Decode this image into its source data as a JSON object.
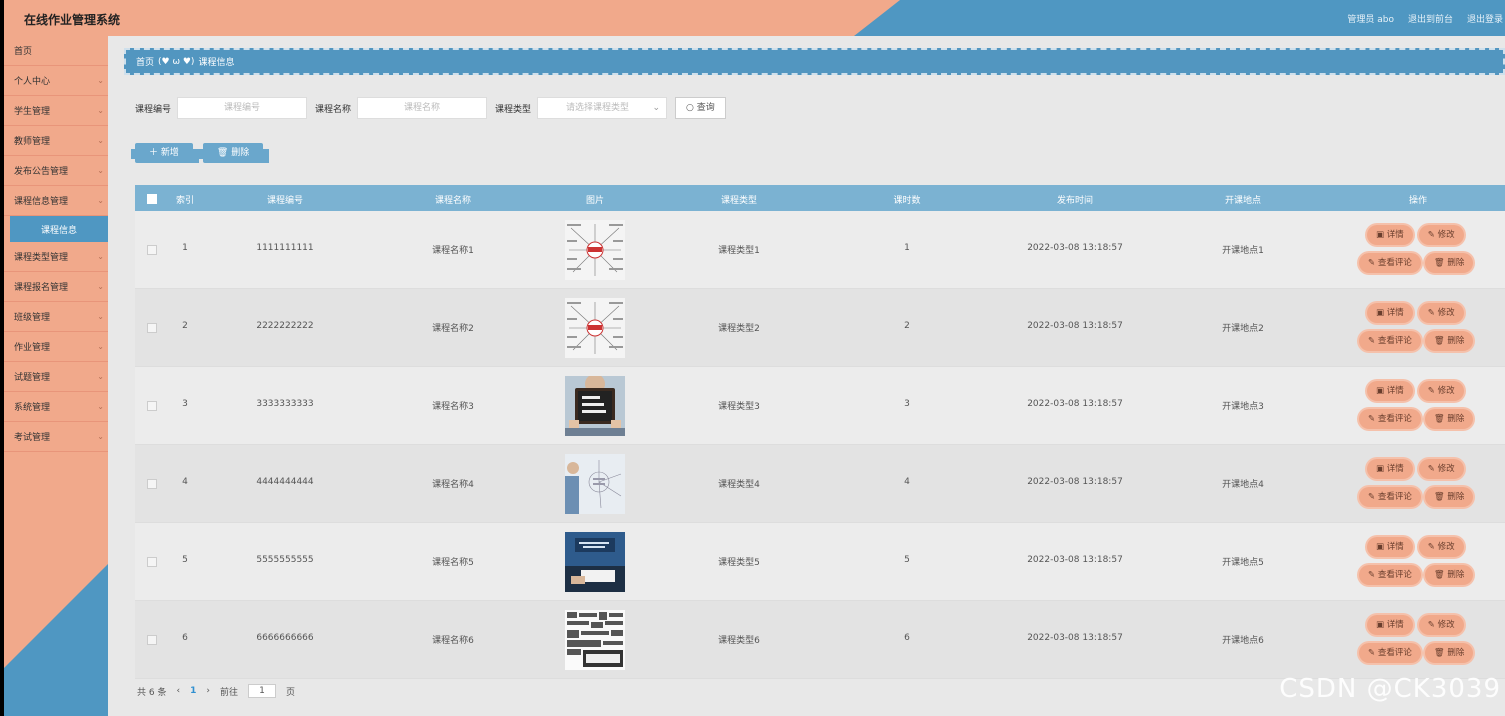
{
  "header": {
    "title": "在线作业管理系统",
    "user": "管理员 abo",
    "to_front": "退出到前台",
    "logout": "退出登录"
  },
  "sidebar": {
    "items": [
      {
        "label": "首页",
        "has_chevron": false
      },
      {
        "label": "个人中心",
        "has_chevron": true
      },
      {
        "label": "学生管理",
        "has_chevron": true
      },
      {
        "label": "教师管理",
        "has_chevron": true
      },
      {
        "label": "发布公告管理",
        "has_chevron": true
      },
      {
        "label": "课程信息管理",
        "has_chevron": true
      },
      {
        "label": "课程类型管理",
        "has_chevron": true
      },
      {
        "label": "课程报名管理",
        "has_chevron": true
      },
      {
        "label": "班级管理",
        "has_chevron": true
      },
      {
        "label": "作业管理",
        "has_chevron": true
      },
      {
        "label": "试题管理",
        "has_chevron": true
      },
      {
        "label": "系统管理",
        "has_chevron": true
      },
      {
        "label": "考试管理",
        "has_chevron": true
      }
    ],
    "active_sub": "课程信息"
  },
  "breadcrumb": {
    "home": "首页",
    "sep": "(♥ ω ♥)",
    "current": "课程信息"
  },
  "search": {
    "code_label": "课程编号",
    "code_placeholder": "课程编号",
    "name_label": "课程名称",
    "name_placeholder": "课程名称",
    "type_label": "课程类型",
    "type_placeholder": "请选择课程类型",
    "query": "查询"
  },
  "toolbar": {
    "add": "新增",
    "delete": "删除"
  },
  "table": {
    "headers": [
      "索引",
      "课程编号",
      "课程名称",
      "图片",
      "课程类型",
      "课时数",
      "发布时间",
      "开课地点",
      "操作"
    ],
    "rows": [
      {
        "index": "1",
        "code": "1111111111",
        "name": "课程名称1",
        "type": "课程类型1",
        "hours": "1",
        "time": "2022-03-08 13:18:57",
        "place": "开课地点1",
        "img": "have"
      },
      {
        "index": "2",
        "code": "2222222222",
        "name": "课程名称2",
        "type": "课程类型2",
        "hours": "2",
        "time": "2022-03-08 13:18:57",
        "place": "开课地点2",
        "img": "have"
      },
      {
        "index": "3",
        "code": "3333333333",
        "name": "课程名称3",
        "type": "课程类型3",
        "hours": "3",
        "time": "2022-03-08 13:18:57",
        "place": "开课地点3",
        "img": "chalkboard"
      },
      {
        "index": "4",
        "code": "4444444444",
        "name": "课程名称4",
        "type": "课程类型4",
        "hours": "4",
        "time": "2022-03-08 13:18:57",
        "place": "开课地点4",
        "img": "sketch"
      },
      {
        "index": "5",
        "code": "5555555555",
        "name": "课程名称5",
        "type": "课程类型5",
        "hours": "5",
        "time": "2022-03-08 13:18:57",
        "place": "开课地点5",
        "img": "book"
      },
      {
        "index": "6",
        "code": "6666666666",
        "name": "课程名称6",
        "type": "课程类型6",
        "hours": "6",
        "time": "2022-03-08 13:18:57",
        "place": "开课地点6",
        "img": "words"
      }
    ],
    "ops": {
      "detail": "详情",
      "edit": "修改",
      "comments": "查看评论",
      "delete": "删除"
    }
  },
  "pager": {
    "total": "共 6 条",
    "prev": "‹",
    "page": "1",
    "next": "›",
    "goto": "前往",
    "page_input": "1",
    "page_unit": "页"
  },
  "watermark": "CSDN @CK3039",
  "colors": {
    "salmon": "#f1a98b",
    "blue": "#4f97c2",
    "table_head": "#7bb2d2"
  }
}
